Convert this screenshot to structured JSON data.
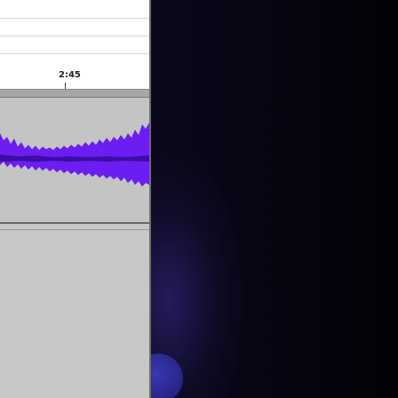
{
  "timeline": {
    "time_label": "2:45"
  },
  "track": {
    "waveform_color": "#6c1df2",
    "waveform_dark": "#3d0da6",
    "background_color": "#c4c4c4"
  },
  "desktop": {
    "background_color": "#0a081a",
    "accent_color": "#2b288f"
  }
}
